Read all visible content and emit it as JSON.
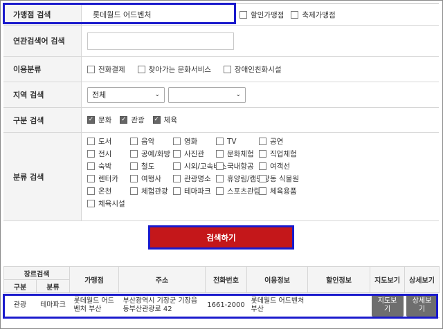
{
  "search_form": {
    "store_search": {
      "label": "가맹점 검색",
      "value": "롯데월드 어드벤처",
      "options": [
        "할인가맹점",
        "축제가맹점"
      ]
    },
    "related_search": {
      "label": "연관검색어 검색",
      "value": ""
    },
    "usage_type": {
      "label": "이용분류",
      "options": [
        "전화결제",
        "찾아가는 문화서비스",
        "장애인친화시설"
      ]
    },
    "region": {
      "label": "지역 검색",
      "select1": "전체",
      "select2": ""
    },
    "division": {
      "label": "구분 검색",
      "options": [
        "문화",
        "관광",
        "체육"
      ]
    },
    "category": {
      "label": "분류 검색",
      "options": [
        "도서",
        "음악",
        "영화",
        "TV",
        "공연",
        "전시",
        "공예/화방",
        "사진관",
        "문화체험",
        "직업체험",
        "숙박",
        "철도",
        "시외/고속버스",
        "국내항공",
        "여객선",
        "렌터카",
        "여행사",
        "관광명소",
        "휴양림/캠핑장",
        "동 식물원",
        "온천",
        "체험관광",
        "테마파크",
        "스포츠관람",
        "체육용품",
        "체육시설"
      ]
    },
    "search_button": "검색하기"
  },
  "results": {
    "group_header": "장르검색",
    "headers": [
      "구분",
      "분류",
      "가맹점",
      "주소",
      "전화번호",
      "이용정보",
      "할인정보",
      "지도보기",
      "상세보기"
    ],
    "rows": [
      {
        "division": "관광",
        "category": "테마파크",
        "store": "롯데월드 어드벤처 부산",
        "address": "부산광역시 기장군 기장읍 동부산관광로 42",
        "phone": "1661-2000",
        "usage": "롯데월드 어드벤처 부산",
        "discount": "",
        "map_button": "지도보기",
        "detail_button": "상세보기"
      }
    ]
  }
}
